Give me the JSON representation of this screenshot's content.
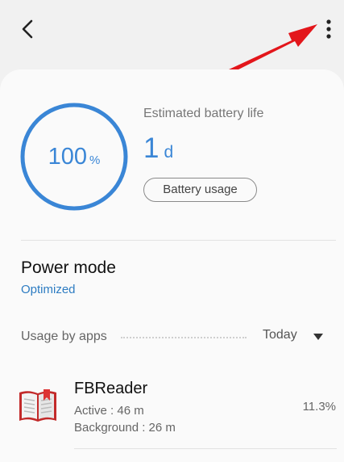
{
  "header": {
    "back_icon": "chevron-left-icon",
    "more_icon": "more-vertical-icon"
  },
  "battery": {
    "percent": "100",
    "percent_unit": "%",
    "estimated_label": "Estimated battery life",
    "estimated_value": "1",
    "estimated_unit": "d",
    "usage_button": "Battery usage"
  },
  "power_mode": {
    "title": "Power mode",
    "value": "Optimized"
  },
  "usage_by_apps": {
    "label": "Usage by apps",
    "period": "Today",
    "apps": [
      {
        "name": "FBReader",
        "active": "Active : 46 m",
        "background": "Background : 26 m",
        "percent": "11.3%",
        "icon": "book-icon"
      }
    ]
  },
  "colors": {
    "accent": "#3a86d6",
    "link": "#2d7cc2",
    "annotation": "#e3161b",
    "background": "#f1f1f1",
    "card": "#fafafa"
  }
}
